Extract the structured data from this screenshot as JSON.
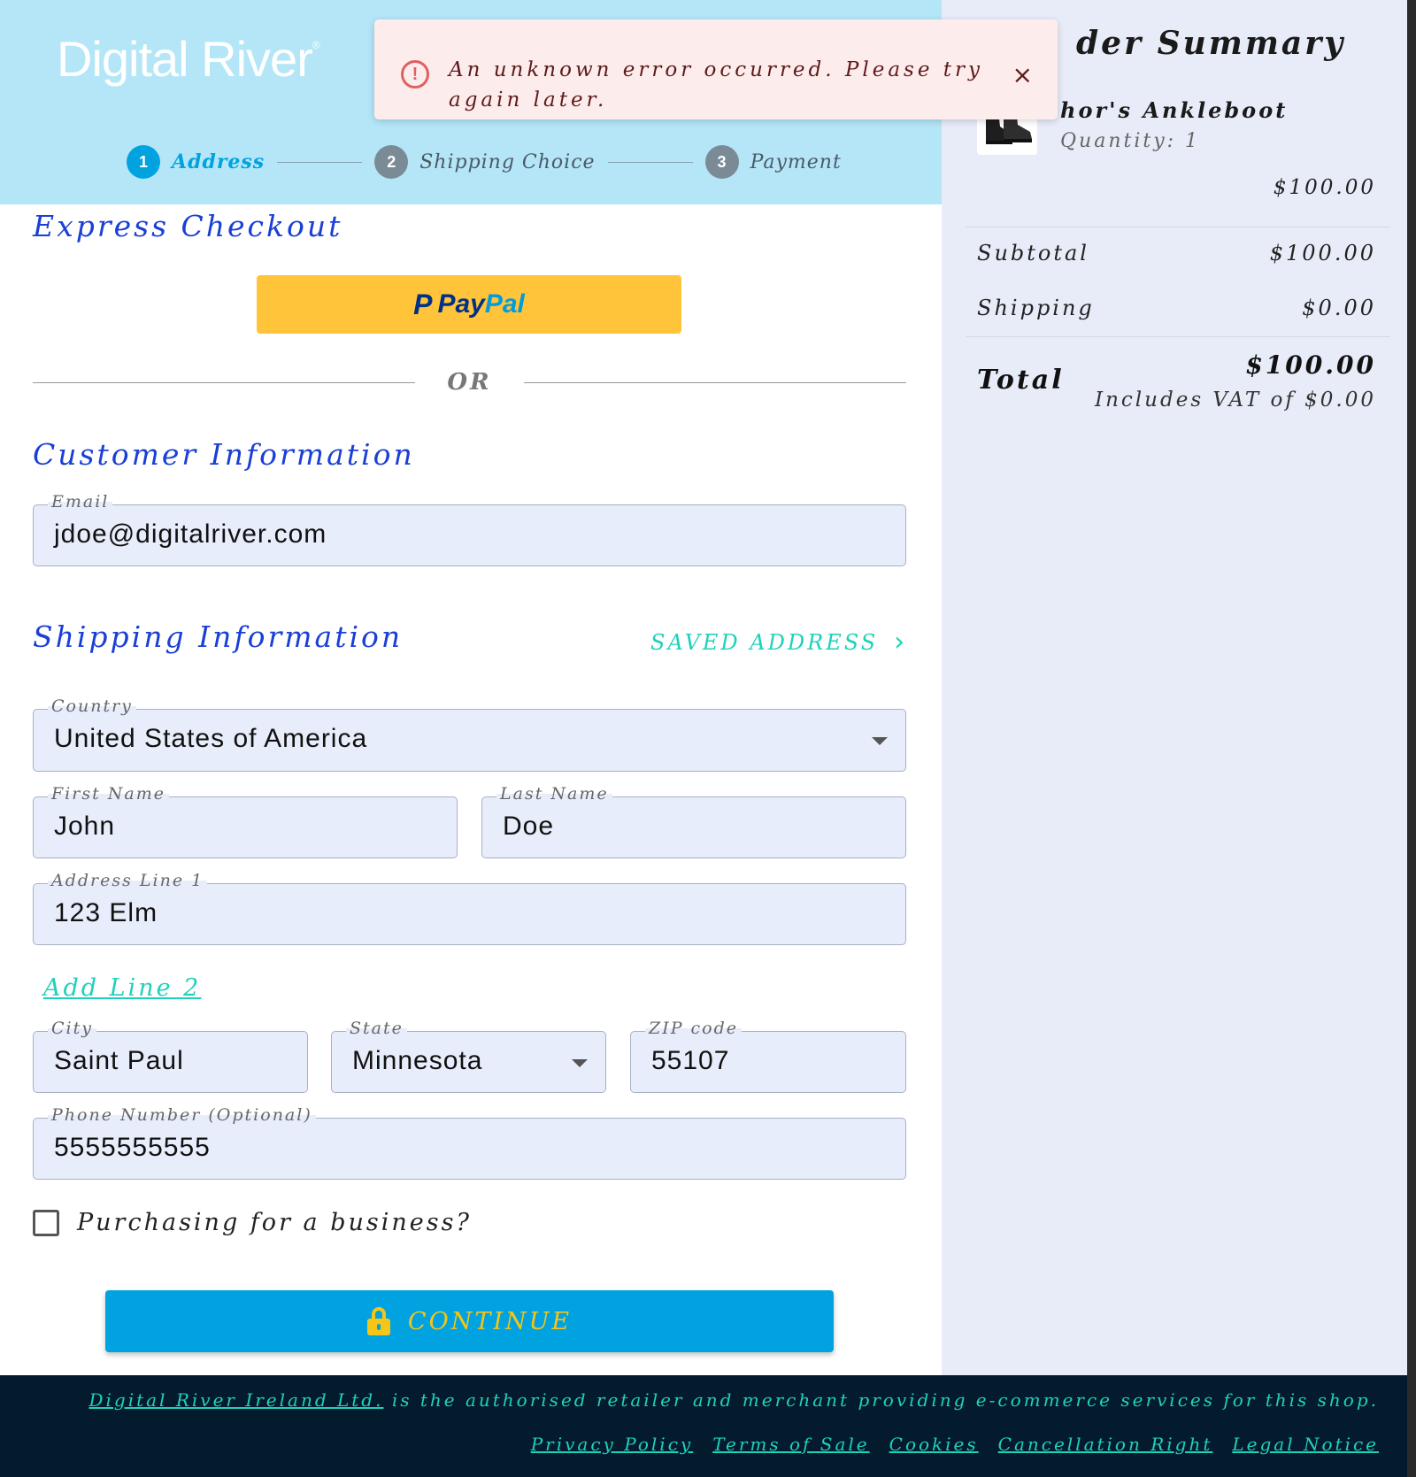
{
  "brand": {
    "logo_text": "Digital River",
    "logo_mark": "®"
  },
  "stepper": [
    {
      "num": "1",
      "label": "Address",
      "active": true
    },
    {
      "num": "2",
      "label": "Shipping Choice",
      "active": false
    },
    {
      "num": "3",
      "label": "Payment",
      "active": false
    }
  ],
  "express": {
    "title": "Express Checkout",
    "paypal_pay": "Pay",
    "paypal_pal": "Pal",
    "or": "OR"
  },
  "customer": {
    "title": "Customer Information",
    "email_label": "Email",
    "email_value": "jdoe@digitalriver.com"
  },
  "shipping": {
    "title": "Shipping Information",
    "saved_address": "SAVED ADDRESS",
    "country_label": "Country",
    "country_value": "United States of America",
    "first_label": "First Name",
    "first_value": "John",
    "last_label": "Last Name",
    "last_value": "Doe",
    "addr1_label": "Address Line 1",
    "addr1_value": "123 Elm",
    "add_line2": "Add Line 2",
    "city_label": "City",
    "city_value": "Saint Paul",
    "state_label": "State",
    "state_value": "Minnesota",
    "zip_label": "ZIP code",
    "zip_value": "55107",
    "phone_label": "Phone Number (Optional)",
    "phone_value": "5555555555",
    "business_label": "Purchasing for a business?",
    "continue_label": "CONTINUE"
  },
  "toast": {
    "message": "An unknown error occurred. Please try again later.",
    "close": "×"
  },
  "summary": {
    "title": "der Summary",
    "product_name": "hor's Ankleboot",
    "quantity": "Quantity: 1",
    "product_price": "$100.00",
    "subtotal_label": "Subtotal",
    "subtotal_value": "$100.00",
    "shipping_label": "Shipping",
    "shipping_value": "$0.00",
    "total_label": "Total",
    "total_value": "$100.00",
    "vat_note": "Includes VAT of $0.00"
  },
  "footer": {
    "retailer_link": "Digital River Ireland Ltd.",
    "retailer_text": " is the authorised retailer and merchant providing e-commerce services for this shop.",
    "links": [
      "Privacy Policy",
      "Terms of Sale",
      "Cookies",
      "Cancellation Right",
      "Legal Notice"
    ]
  },
  "colors": {
    "accent": "#00a3e0",
    "header_bg": "#b4e6f8",
    "title_blue": "#1a3fd6",
    "teal_link": "#1fd1b9",
    "paypal": "#ffc439",
    "footer_bg": "#041b2e"
  }
}
